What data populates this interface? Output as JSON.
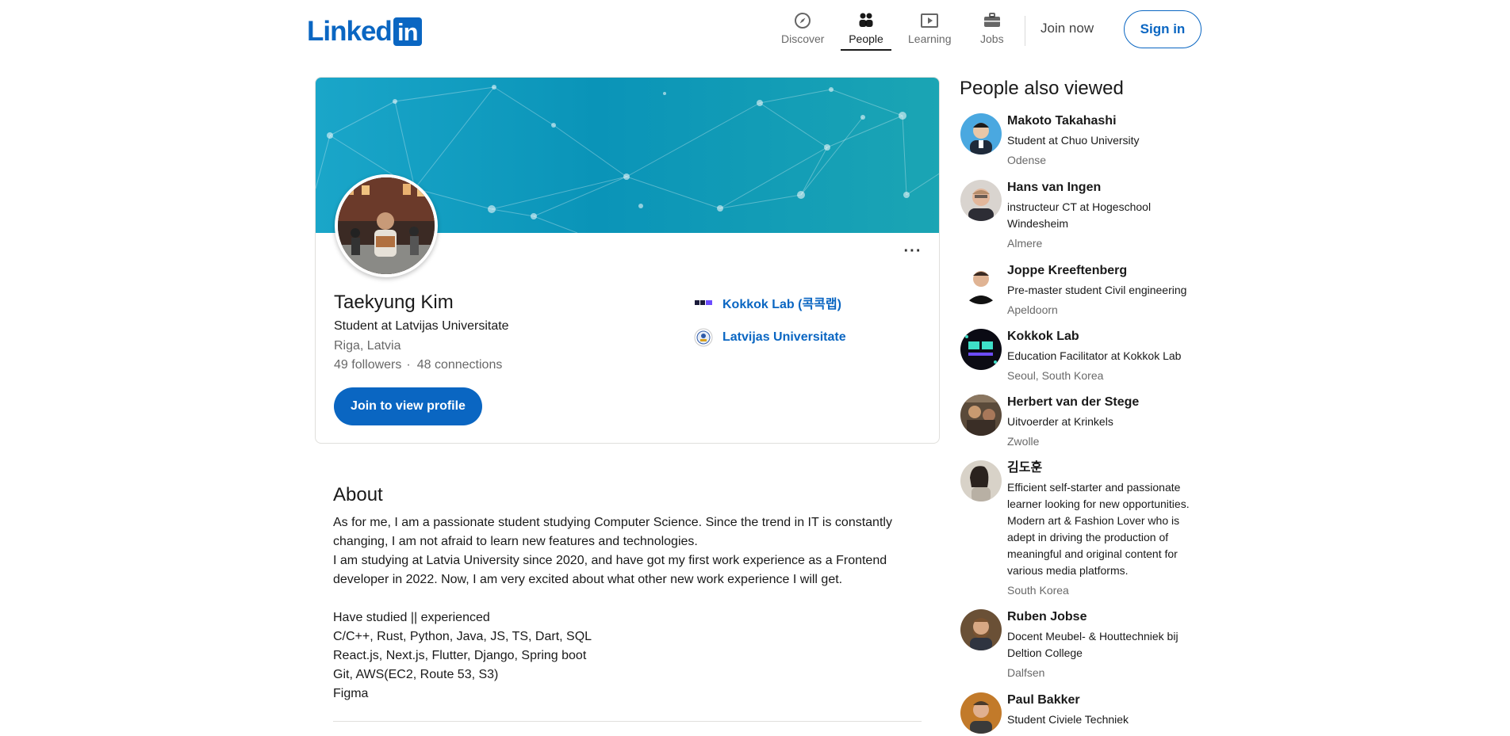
{
  "header": {
    "logo_text": "Linked",
    "logo_box_text": "in",
    "nav": [
      {
        "label": "Discover",
        "icon": "compass-icon"
      },
      {
        "label": "People",
        "icon": "people-icon",
        "active": true
      },
      {
        "label": "Learning",
        "icon": "learning-icon"
      },
      {
        "label": "Jobs",
        "icon": "briefcase-icon"
      }
    ],
    "join_now": "Join now",
    "sign_in": "Sign in"
  },
  "profile": {
    "name": "Taekyung Kim",
    "headline": "Student at Latvijas Universitate",
    "location": "Riga, Latvia",
    "followers": "49 followers",
    "dot": "·",
    "connections": "48 connections",
    "join_button": "Join to view profile",
    "more_label": "···",
    "orgs": [
      {
        "name": "Kokkok Lab (콕콕랩)"
      },
      {
        "name": "Latvijas Universitate"
      }
    ]
  },
  "about": {
    "title": "About",
    "text": "As for me, I am a passionate student studying Computer Science. Since the trend in IT is constantly changing, I am not afraid to learn new features and technologies.\nI am studying at Latvia University since 2020, and have got my first work experience as a Frontend developer in 2022. Now, I am very excited about what other new work experience I will get.\n\nHave studied || experienced\nC/C++, Rust, Python, Java, JS, TS, Dart, SQL\nReact.js, Next.js, Flutter, Django, Spring boot\nGit, AWS(EC2, Route 53, S3)\nFigma"
  },
  "people_also_viewed": {
    "title": "People also viewed",
    "items": [
      {
        "name": "Makoto Takahashi",
        "headline": "Student at Chuo University",
        "location": "Odense"
      },
      {
        "name": "Hans van Ingen",
        "headline": "instructeur CT at Hogeschool Windesheim",
        "location": "Almere"
      },
      {
        "name": "Joppe Kreeftenberg",
        "headline": "Pre-master student Civil engineering",
        "location": "Apeldoorn"
      },
      {
        "name": "Kokkok Lab",
        "headline": "Education Facilitator at Kokkok Lab",
        "location": "Seoul, South Korea"
      },
      {
        "name": "Herbert van der Stege",
        "headline": "Uitvoerder at Krinkels",
        "location": "Zwolle"
      },
      {
        "name": "김도훈",
        "headline": "Efficient self-starter and passionate learner looking for new opportunities. Modern art & Fashion Lover who is adept in driving the production of meaningful and original content for various media platforms.",
        "location": "South Korea"
      },
      {
        "name": "Ruben Jobse",
        "headline": "Docent Meubel- & Houttechniek bij Deltion College",
        "location": "Dalfsen"
      },
      {
        "name": "Paul Bakker",
        "headline": "Student Civiele Techniek",
        "location": ""
      }
    ]
  },
  "colors": {
    "brand": "#0a66c2",
    "banner_start": "#1aa6c9",
    "banner_end": "#1ba5b4"
  }
}
